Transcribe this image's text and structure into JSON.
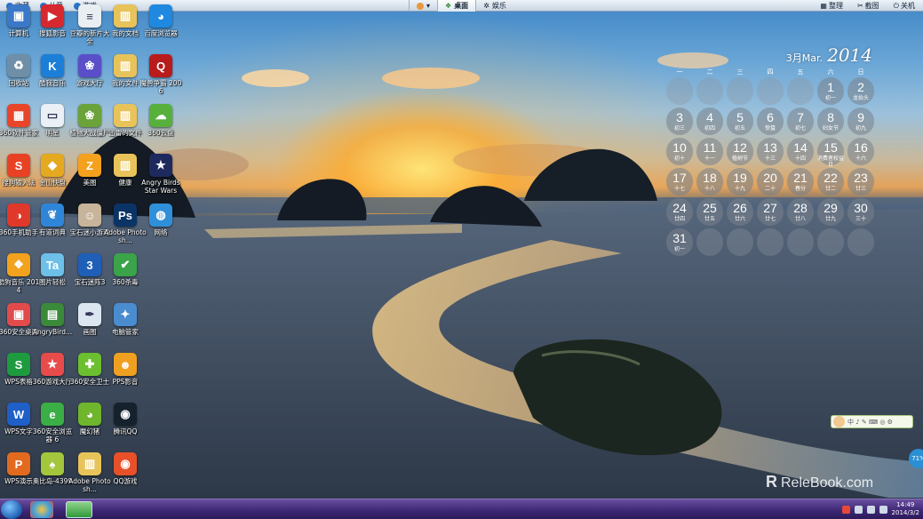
{
  "topbar": {
    "left": [
      "收藏",
      "儿童",
      "游戏"
    ],
    "center_tabs": [
      "桌面",
      "娱乐"
    ],
    "right": [
      "整理",
      "截图",
      "关机"
    ]
  },
  "desktop_icons": [
    {
      "label": "计算机",
      "color": "#3b78c8",
      "glyph": "▣"
    },
    {
      "label": "搜狐影音",
      "color": "#d7282f",
      "glyph": "▶"
    },
    {
      "label": "豆瓣的新片大全",
      "color": "#e9eef2",
      "glyph": "≡"
    },
    {
      "label": "我的文档",
      "color": "#e8c35a",
      "glyph": "▥"
    },
    {
      "label": "百度浏览器",
      "color": "#1f88e0",
      "glyph": "◕"
    },
    {
      "label": "回收站",
      "color": "#6f8fa8",
      "glyph": "♻"
    },
    {
      "label": "酷我音乐",
      "color": "#1b7fd8",
      "glyph": "K"
    },
    {
      "label": "游戏大厅",
      "color": "#5a4fc9",
      "glyph": "❀"
    },
    {
      "label": "我的文件",
      "color": "#e8c35a",
      "glyph": "▥"
    },
    {
      "label": "魔兽争霸 2006",
      "color": "#b81b1b",
      "glyph": "Q"
    },
    {
      "label": "360软件管家",
      "color": "#e8452a",
      "glyph": "▦"
    },
    {
      "label": "明星",
      "color": "#eaf0f6",
      "glyph": "▭"
    },
    {
      "label": "植物大战僵尸",
      "color": "#6aa33a",
      "glyph": "❀"
    },
    {
      "label": "迅雷的文件",
      "color": "#e8c35a",
      "glyph": "▥"
    },
    {
      "label": "360云盘",
      "color": "#58b03c",
      "glyph": "☁"
    },
    {
      "label": "搜狗输入法",
      "color": "#e94124",
      "glyph": "S"
    },
    {
      "label": "金山快盘",
      "color": "#e5a91f",
      "glyph": "◆"
    },
    {
      "label": "美图",
      "color": "#f4a11d",
      "glyph": "Z"
    },
    {
      "label": "健康",
      "color": "#e8c35a",
      "glyph": "▥"
    },
    {
      "label": "Angry Birds Star Wars",
      "color": "#1e2a5e",
      "glyph": "★"
    },
    {
      "label": "360手机助手",
      "color": "#e0392b",
      "glyph": "◑"
    },
    {
      "label": "有道词典",
      "color": "#2f86d8",
      "glyph": "❦"
    },
    {
      "label": "宝石迷小游戏",
      "color": "#c8b49a",
      "glyph": "☺"
    },
    {
      "label": "Adobe Photosh...",
      "color": "#0b3466",
      "glyph": "Ps"
    },
    {
      "label": "网络",
      "color": "#2f8fd8",
      "glyph": "◍"
    },
    {
      "label": "酷狗音乐 2014",
      "color": "#f2a21d",
      "glyph": "❖"
    },
    {
      "label": "图片轻松",
      "color": "#6dc0e8",
      "glyph": "Ta"
    },
    {
      "label": "宝石迷阵3",
      "color": "#1f5fb8",
      "glyph": "3"
    },
    {
      "label": "360杀毒",
      "color": "#3ba34a",
      "glyph": "✔"
    },
    {
      "label": "360安全桌面",
      "color": "#e24b4b",
      "glyph": "▣"
    },
    {
      "label": "AngryBird...",
      "color": "#3a8a3a",
      "glyph": "▤"
    },
    {
      "label": "画图",
      "color": "#dbe6f0",
      "glyph": "✒"
    },
    {
      "label": "电脑管家",
      "color": "#4a8cd0",
      "glyph": "✦"
    },
    {
      "label": "WPS表格",
      "color": "#1f9b3f",
      "glyph": "S"
    },
    {
      "label": "360游戏大厅",
      "color": "#e84b4b",
      "glyph": "★"
    },
    {
      "label": "360安全卫士",
      "color": "#6cbf2f",
      "glyph": "✚"
    },
    {
      "label": "PPS影音",
      "color": "#f0a020",
      "glyph": "☻"
    },
    {
      "label": "WPS文字",
      "color": "#1f5fc8",
      "glyph": "W"
    },
    {
      "label": "360安全浏览器 6",
      "color": "#3bae45",
      "glyph": "e"
    },
    {
      "label": "魔幻猪",
      "color": "#6fb62d",
      "glyph": "◕"
    },
    {
      "label": "腾讯QQ",
      "color": "#15222e",
      "glyph": "◉"
    },
    {
      "label": "WPS演示",
      "color": "#e26a1f",
      "glyph": "P"
    },
    {
      "label": "奥比岛-4399",
      "color": "#a3c63c",
      "glyph": "♠"
    },
    {
      "label": "Adobe Photosh...",
      "color": "#e8c35a",
      "glyph": "▥"
    },
    {
      "label": "QQ游戏",
      "color": "#e8502a",
      "glyph": "◉"
    }
  ],
  "calendar": {
    "month": "3月",
    "month_en": "Mar.",
    "year": "2014",
    "weekdays": [
      "一",
      "二",
      "三",
      "四",
      "五",
      "六",
      "日"
    ],
    "days": [
      {
        "d": "",
        "l": ""
      },
      {
        "d": "",
        "l": ""
      },
      {
        "d": "",
        "l": ""
      },
      {
        "d": "",
        "l": ""
      },
      {
        "d": "",
        "l": ""
      },
      {
        "d": "1",
        "l": "初一"
      },
      {
        "d": "2",
        "l": "龙抬头"
      },
      {
        "d": "3",
        "l": "初三"
      },
      {
        "d": "4",
        "l": "初四"
      },
      {
        "d": "5",
        "l": "初五"
      },
      {
        "d": "6",
        "l": "惊蛰"
      },
      {
        "d": "7",
        "l": "初七"
      },
      {
        "d": "8",
        "l": "妇女节"
      },
      {
        "d": "9",
        "l": "初九"
      },
      {
        "d": "10",
        "l": "初十"
      },
      {
        "d": "11",
        "l": "十一"
      },
      {
        "d": "12",
        "l": "植树节"
      },
      {
        "d": "13",
        "l": "十三"
      },
      {
        "d": "14",
        "l": "十四"
      },
      {
        "d": "15",
        "l": "消费者权益日"
      },
      {
        "d": "16",
        "l": "十六"
      },
      {
        "d": "17",
        "l": "十七"
      },
      {
        "d": "18",
        "l": "十八"
      },
      {
        "d": "19",
        "l": "十九"
      },
      {
        "d": "20",
        "l": "二十"
      },
      {
        "d": "21",
        "l": "春分"
      },
      {
        "d": "22",
        "l": "廿二"
      },
      {
        "d": "23",
        "l": "廿三"
      },
      {
        "d": "24",
        "l": "廿四"
      },
      {
        "d": "25",
        "l": "廿五"
      },
      {
        "d": "26",
        "l": "廿六"
      },
      {
        "d": "27",
        "l": "廿七"
      },
      {
        "d": "28",
        "l": "廿八"
      },
      {
        "d": "29",
        "l": "廿九"
      },
      {
        "d": "30",
        "l": "三十"
      },
      {
        "d": "31",
        "l": "初一"
      },
      {
        "d": "",
        "l": ""
      },
      {
        "d": "",
        "l": ""
      },
      {
        "d": "",
        "l": ""
      },
      {
        "d": "",
        "l": ""
      },
      {
        "d": "",
        "l": ""
      },
      {
        "d": "",
        "l": ""
      }
    ]
  },
  "widget_bar": {
    "text": "中 ♪ ✎ ⌨ ◎ ⚙"
  },
  "battery_badge": "71%",
  "watermark": {
    "mark": "R",
    "text": "ReleBook.com"
  },
  "taskbar": {
    "time": "14:49",
    "date": "2014/3/2"
  }
}
